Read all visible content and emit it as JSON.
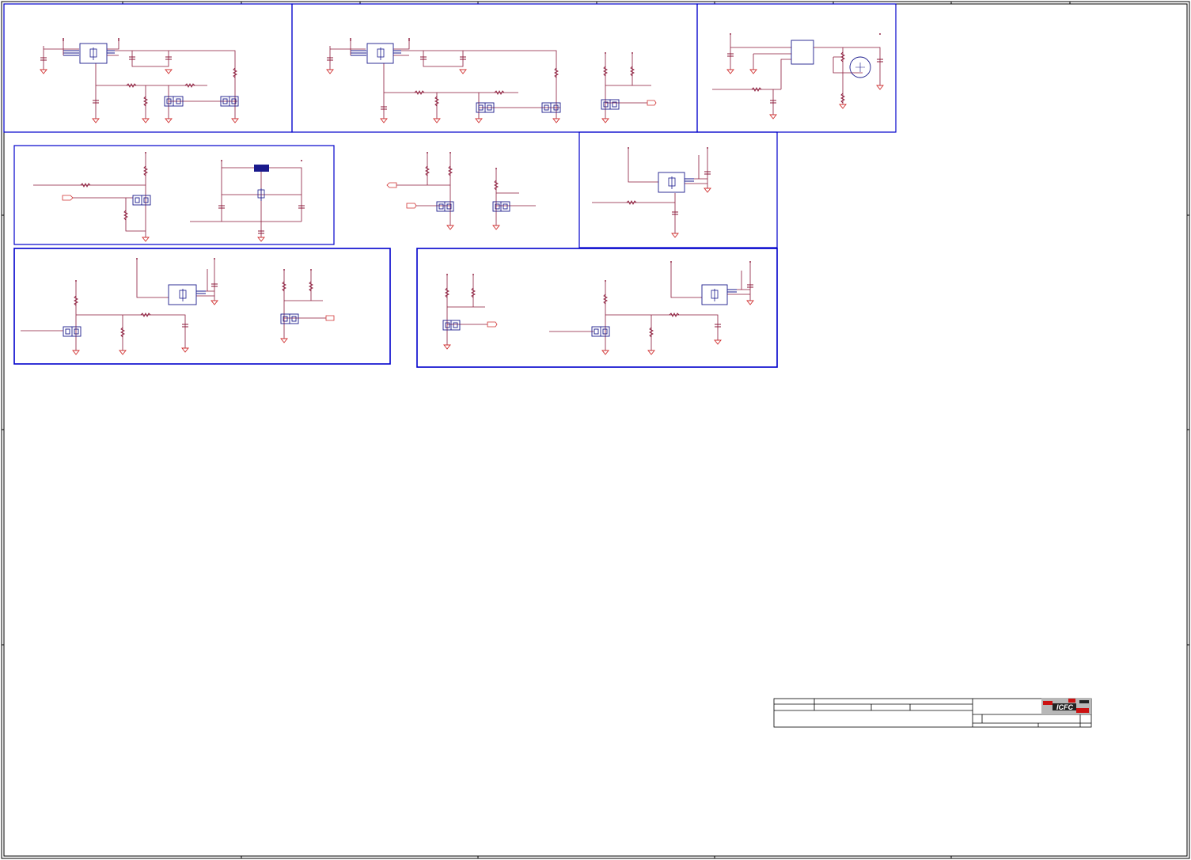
{
  "colors": {
    "frame": "#000000",
    "block_border": "#0000cc",
    "wire": "#8b1a3a",
    "component": "#1a1a8c",
    "ground": "#d03030",
    "port": "#d03030",
    "logo_bg": "#b8b8b8",
    "logo_red": "#cc1111",
    "logo_dark": "#222222"
  },
  "title_block": {
    "logo_text": "ICFC"
  }
}
